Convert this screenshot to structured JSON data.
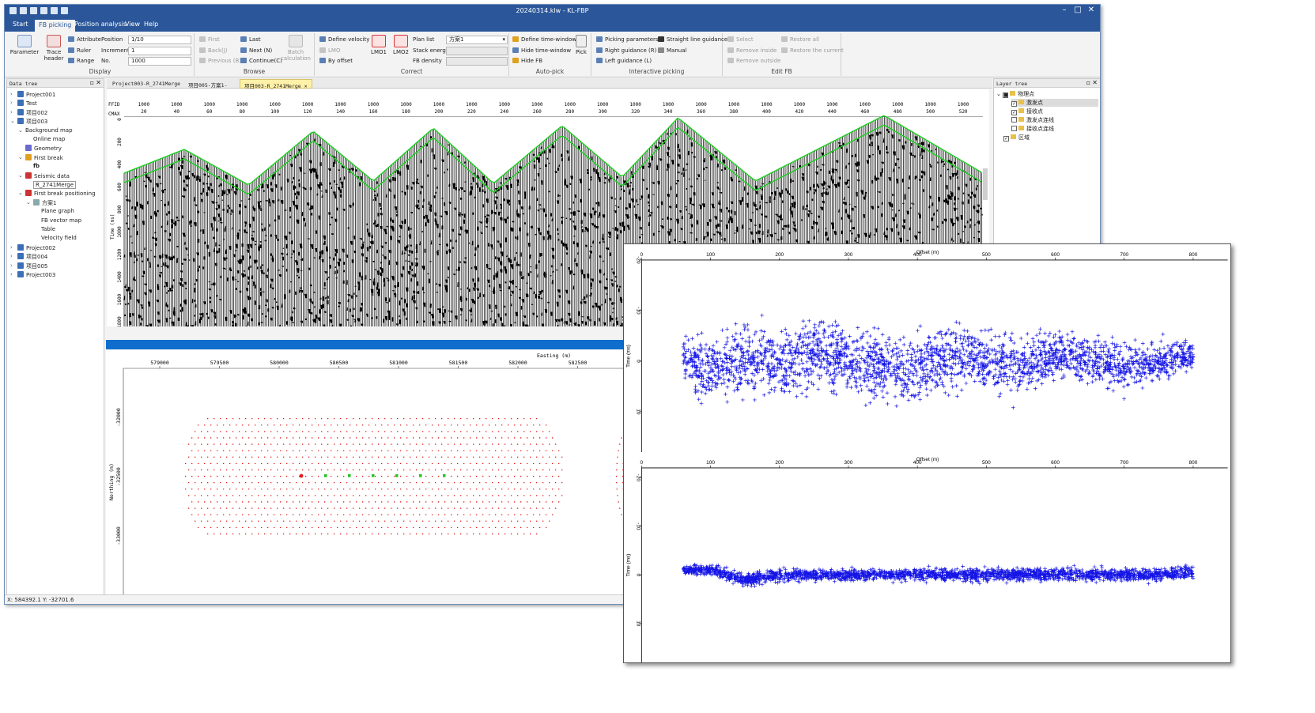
{
  "window": {
    "title": "20240314.klw - KL-FBP",
    "controls": {
      "minimize": "–",
      "maximize": "□",
      "close": "✕"
    }
  },
  "menu": [
    "Start",
    "FB picking",
    "Position analysis",
    "View",
    "Help"
  ],
  "ribbon": {
    "display": {
      "label": "Display",
      "parameter": "Parameter",
      "trace_header": "Trace header",
      "attribute": "Attribute",
      "ruler": "Ruler",
      "range": "Range",
      "position_label": "Position",
      "position_value": "1/10",
      "increment_label": "Increment",
      "increment_value": "1",
      "no_label": "No.",
      "no_value": "1000"
    },
    "browse": {
      "label": "Browse",
      "first": "First",
      "back": "Back(J)",
      "previous": "Previous (B)",
      "last": "Last",
      "next": "Next (N)",
      "continue": "Continue(C)",
      "batch": "Batch calculation"
    },
    "correct": {
      "label": "Correct",
      "define_velocity": "Define velocity",
      "lmo": "LMO",
      "by_offset": "By offset",
      "lmo1": "LMO1",
      "lmo2": "LMO2",
      "plan_list": "Plan list",
      "plan_value": "方案1",
      "stack_energy": "Stack energy",
      "fb_density": "FB density"
    },
    "autopick": {
      "label": "Auto-pick",
      "define_tw": "Define time-window",
      "hide_tw": "Hide time-window",
      "hide_fb": "Hide FB",
      "pick": "Pick"
    },
    "interactive": {
      "label": "Interactive picking",
      "picking_params": "Picking parameters",
      "straight_line": "Straight line guidance",
      "right_guidance": "Right guidance (R)",
      "manual": "Manual",
      "left_guidance": "Left guidance (L)"
    },
    "editfb": {
      "label": "Edit FB",
      "select": "Select",
      "remove_inside": "Remove inside",
      "remove_outside": "Remove outside",
      "restore_all": "Restore all",
      "restore_current": "Restore the current"
    }
  },
  "data_tree": {
    "title": "Data tree",
    "items": [
      "Project001",
      "Test",
      "项目002",
      "项目003",
      "Background map",
      "Online map",
      "Geometry",
      "First break",
      "fb",
      "Seismic data",
      "R_2741Merge",
      "First break positioning",
      "方案1",
      "Plane graph",
      "FB vector map",
      "Table",
      "Velocity field",
      "Project002",
      "项目004",
      "项目005",
      "Project003"
    ]
  },
  "doc_tabs": [
    "Project003-R_2741Merge",
    "项目005-方案1-",
    "项目003-R_2741Merge"
  ],
  "seismic": {
    "ffid_label": "FFID",
    "cmax_label": "CMAX",
    "ffid_value": "1000",
    "traces": [
      "20",
      "40",
      "60",
      "80",
      "100",
      "120",
      "140",
      "160",
      "180",
      "200",
      "220",
      "240",
      "260",
      "280",
      "300",
      "320",
      "340",
      "360",
      "380",
      "400",
      "420",
      "440",
      "460",
      "480",
      "500",
      "520"
    ],
    "time_label": "Time (ms)",
    "times": [
      "0",
      "200",
      "400",
      "600",
      "800",
      "1000",
      "1200",
      "1400",
      "1600",
      "1800"
    ],
    "fb_color": "#19d11e"
  },
  "map": {
    "easting_label": "Easting (m)",
    "northing_label": "Northing (m)",
    "eastings": [
      "579000",
      "579500",
      "580000",
      "580500",
      "581000",
      "581500",
      "582000",
      "582500"
    ],
    "northings": [
      "-32000",
      "-32500",
      "-33000"
    ],
    "source_color": "#e31a1a",
    "receiver_color": "#1fc21f"
  },
  "layer_tree": {
    "title": "Layer tree",
    "items": [
      "物理点",
      "激发点",
      "接收点",
      "激发点连线",
      "接收点连线",
      "区域"
    ]
  },
  "status": "X: 584392.1  Y: -32701.6",
  "popup": {
    "offset_label": "Offset (m)",
    "time_label": "Time (ms)",
    "offset_ticks": [
      "0",
      "100",
      "200",
      "300",
      "400",
      "500",
      "600",
      "700",
      "800"
    ],
    "time_ticks": [
      "-20",
      "-10",
      "0",
      "10"
    ],
    "marker_color": "#1414e6"
  },
  "chart_data": [
    {
      "type": "scatter",
      "title": "",
      "xlabel": "Offset (m)",
      "ylabel": "Time (ms)",
      "xlim": [
        0,
        850
      ],
      "ylim": [
        -20,
        18
      ],
      "y_inverted": true,
      "series": [
        {
          "marker": "+",
          "x": [
            60,
            100,
            150,
            200,
            250,
            300,
            350,
            400,
            450,
            500,
            550,
            600,
            650,
            700,
            750,
            800
          ],
          "y": [
            0,
            2,
            -1,
            1,
            -2,
            0,
            1,
            2,
            -1,
            0,
            1,
            -1,
            0,
            1,
            0,
            -1
          ],
          "spread": [
            8,
            9,
            11,
            10,
            10,
            10,
            10,
            10,
            10,
            9,
            9,
            8,
            7,
            7,
            6,
            5
          ]
        }
      ]
    },
    {
      "type": "scatter",
      "title": "",
      "xlabel": "Offset (m)",
      "ylabel": "Time (ms)",
      "xlim": [
        0,
        850
      ],
      "ylim": [
        -22,
        18
      ],
      "y_inverted": true,
      "series": [
        {
          "marker": "+",
          "x": [
            60,
            100,
            150,
            200,
            250,
            300,
            350,
            400,
            450,
            500,
            550,
            600,
            650,
            700,
            750,
            800
          ],
          "y": [
            -1,
            -1,
            1,
            0,
            0,
            0,
            0,
            0,
            0,
            0,
            0,
            0,
            0,
            0,
            0,
            -0.5
          ],
          "spread": [
            1.5,
            1.5,
            2,
            2,
            1.8,
            1.8,
            1.8,
            2,
            2,
            2,
            2,
            2,
            2,
            2,
            2,
            2
          ]
        }
      ]
    }
  ]
}
